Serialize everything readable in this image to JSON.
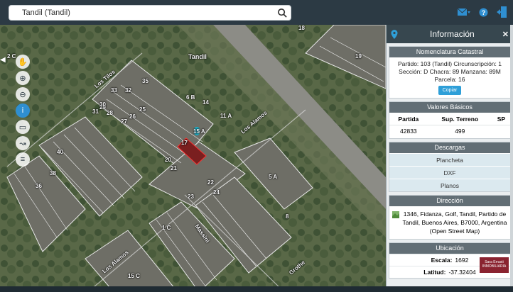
{
  "search": {
    "value": "Tandil (Tandil)"
  },
  "header_icons": [
    "envelope-icon",
    "help-icon",
    "logout-icon"
  ],
  "map": {
    "labels": {
      "tandil": "Tandil",
      "los_tilos": "Los Tilos",
      "los_alamos_top": "Los Alamos",
      "los_alamos_bottom": "Los Alamos",
      "massini": "Massini",
      "grothe": "Grothe",
      "lot_15a": "15 A",
      "lot_17": "17",
      "lot_14": "14",
      "lot_20": "20",
      "lot_21": "21",
      "lot_22": "22",
      "lot_23": "23",
      "lot_24": "24",
      "lot_25": "25",
      "lot_26": "26",
      "lot_27": "27",
      "lot_28": "28",
      "lot_29": "29",
      "lot_30": "30",
      "lot_31": "31",
      "lot_32": "32",
      "lot_33": "33",
      "lot_35": "35",
      "lot_36": "36",
      "lot_38": "38",
      "lot_40": "40",
      "lot_5a": "5 A",
      "lot_1c": "1 C",
      "lot_15c": "15 C",
      "lot_8": "8",
      "lot_18": "18",
      "lot_19": "19",
      "lot_11a": "11 A",
      "lot_6b": "6 B",
      "lot_2c": "2 C"
    },
    "tools": [
      "pan-hand-icon",
      "zoom-in-icon",
      "zoom-out-icon",
      "info-icon",
      "measure-icon",
      "route-icon",
      "layers-icon"
    ]
  },
  "panel": {
    "title": "Información",
    "nomenclatura": {
      "header": "Nomenclatura Catastral",
      "line1": "Partido: 103 (Tandil) Circunscripción: 1",
      "line2": "Sección: D Chacra: 89 Manzana: 89M",
      "line3": "Parcela: 16",
      "copy_label": "Copiar"
    },
    "valores": {
      "header": "Valores Básicos",
      "columns": [
        "Partida",
        "Sup. Terreno",
        "SP"
      ],
      "row": [
        "42833",
        "499",
        ""
      ]
    },
    "descargas": {
      "header": "Descargas",
      "items": [
        "Plancheta",
        "DXF",
        "Planos"
      ]
    },
    "direccion": {
      "header": "Dirección",
      "text": "1346, Fidanza, Golf, Tandil, Partido de Tandil, Buenos Aires, B7000, Argentina (Open Street Map)"
    },
    "ubicacion": {
      "header": "Ubicación",
      "escala_label": "Escala:",
      "escala_value": "1692",
      "latitud_label": "Latitud:",
      "latitud_value": "-37.32404"
    }
  },
  "logo_text": "Sara Errasti INMOBILIARIA"
}
